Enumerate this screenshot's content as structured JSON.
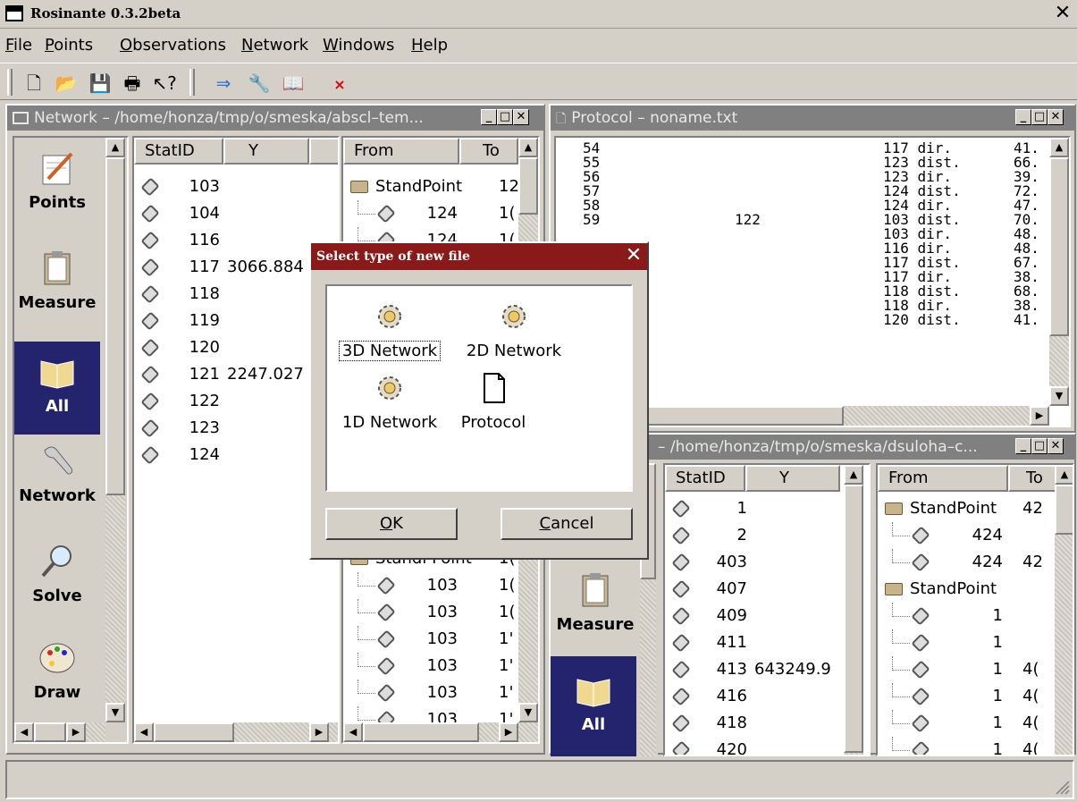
{
  "app": {
    "title": "Rosinante 0.3.2beta"
  },
  "menu": [
    {
      "label": "File",
      "key": "F",
      "rest": "ile"
    },
    {
      "label": "Points",
      "key": "P",
      "rest": "oints"
    },
    {
      "label": "Observations",
      "key": "O",
      "rest": "bservations"
    },
    {
      "label": "Network",
      "key": "N",
      "rest": "etwork"
    },
    {
      "label": "Windows",
      "key": "W",
      "rest": "indows"
    },
    {
      "label": "Help",
      "key": "H",
      "rest": "elp"
    }
  ],
  "toolbar": {
    "icons": [
      "new-file-icon",
      "open-folder-icon",
      "save-disk-icon",
      "print-icon",
      "whats-this-icon",
      "arrow-right-icon",
      "wrench-icon",
      "open-book-icon",
      "close-x-icon"
    ]
  },
  "network_window": {
    "title": "Network – /home/honza/tmp/o/smeska/abscl–tem...",
    "sidebar": [
      "Points",
      "Measure",
      "All",
      "Network",
      "Solve",
      "Draw"
    ],
    "selected_sidebar": "All",
    "points_header": [
      "StatID",
      "Y"
    ],
    "points": [
      {
        "id": "103",
        "y": ""
      },
      {
        "id": "104",
        "y": ""
      },
      {
        "id": "116",
        "y": ""
      },
      {
        "id": "117",
        "y": "3066.884"
      },
      {
        "id": "118",
        "y": ""
      },
      {
        "id": "119",
        "y": ""
      },
      {
        "id": "120",
        "y": ""
      },
      {
        "id": "121",
        "y": "2247.027"
      },
      {
        "id": "122",
        "y": ""
      },
      {
        "id": "123",
        "y": ""
      },
      {
        "id": "124",
        "y": ""
      }
    ],
    "obs_header": [
      "From",
      "To"
    ],
    "obs_top": [
      {
        "kind": "standpoint",
        "label": "StandPoint",
        "to": "12"
      },
      {
        "kind": "point",
        "label": "124",
        "to": "1("
      },
      {
        "kind": "point",
        "label": "124",
        "to": "1("
      }
    ],
    "obs_bottom": [
      {
        "kind": "standpoint",
        "label": "Standi Point",
        "to": "1("
      },
      {
        "kind": "point",
        "label": "103",
        "to": "1("
      },
      {
        "kind": "point",
        "label": "103",
        "to": "1("
      },
      {
        "kind": "point",
        "label": "103",
        "to": "1'"
      },
      {
        "kind": "point",
        "label": "103",
        "to": "1'"
      },
      {
        "kind": "point",
        "label": "103",
        "to": "1'"
      },
      {
        "kind": "point",
        "label": "103",
        "to": "1'"
      }
    ]
  },
  "protocol_window": {
    "title": "Protocol  –  noname.txt",
    "lines": [
      {
        "n": "54",
        "mid": "",
        "obs": "117 dir.",
        "val": "41."
      },
      {
        "n": "55",
        "mid": "",
        "obs": "123 dist.",
        "val": "66."
      },
      {
        "n": "56",
        "mid": "",
        "obs": "123 dir.",
        "val": "39."
      },
      {
        "n": "57",
        "mid": "",
        "obs": "124 dist.",
        "val": "72."
      },
      {
        "n": "58",
        "mid": "",
        "obs": "124 dir.",
        "val": "47."
      },
      {
        "n": "59",
        "mid": "122",
        "obs": "103 dist.",
        "val": "70."
      },
      {
        "n": "",
        "mid": "",
        "obs": "103 dir.",
        "val": "48."
      },
      {
        "n": "",
        "mid": "",
        "obs": "116 dir.",
        "val": "48."
      },
      {
        "n": "",
        "mid": "",
        "obs": "117 dist.",
        "val": "67."
      },
      {
        "n": "",
        "mid": "",
        "obs": "117 dir.",
        "val": "38."
      },
      {
        "n": "",
        "mid": "",
        "obs": "118 dist.",
        "val": "68."
      },
      {
        "n": "",
        "mid": "",
        "obs": "118 dir.",
        "val": "38."
      },
      {
        "n": "",
        "mid": "",
        "obs": "120 dist.",
        "val": "41."
      }
    ]
  },
  "network_window_2": {
    "title": "– /home/honza/tmp/o/smeska/dsuloha–c...",
    "sidebar": [
      "Measure",
      "All"
    ],
    "points_header": [
      "StatID",
      "Y"
    ],
    "points": [
      {
        "id": "1",
        "y": ""
      },
      {
        "id": "2",
        "y": ""
      },
      {
        "id": "403",
        "y": ""
      },
      {
        "id": "407",
        "y": ""
      },
      {
        "id": "409",
        "y": ""
      },
      {
        "id": "411",
        "y": ""
      },
      {
        "id": "413",
        "y": "643249.9"
      },
      {
        "id": "416",
        "y": ""
      },
      {
        "id": "418",
        "y": ""
      },
      {
        "id": "420",
        "y": ""
      }
    ],
    "obs_header": [
      "From",
      "To"
    ],
    "obs": [
      {
        "kind": "standpoint",
        "label": "StandPoint",
        "to": "42"
      },
      {
        "kind": "point",
        "label": "424",
        "to": ""
      },
      {
        "kind": "point",
        "label": "424",
        "to": "42"
      },
      {
        "kind": "standpoint",
        "label": "StandPoint",
        "to": ""
      },
      {
        "kind": "point",
        "label": "1",
        "to": ""
      },
      {
        "kind": "point",
        "label": "1",
        "to": ""
      },
      {
        "kind": "point",
        "label": "1",
        "to": "4("
      },
      {
        "kind": "point",
        "label": "1",
        "to": "4("
      },
      {
        "kind": "point",
        "label": "1",
        "to": "4("
      },
      {
        "kind": "point",
        "label": "1",
        "to": "4("
      }
    ]
  },
  "dialog": {
    "title": "Select type of new file",
    "items": [
      "3D Network",
      "2D Network",
      "1D Network",
      "Protocol"
    ],
    "selected": "3D Network",
    "ok_label": "OK",
    "ok_key": "O",
    "ok_rest": "K",
    "cancel_label": "Cancel",
    "cancel_key": "C",
    "cancel_rest": "ancel"
  },
  "colors": {
    "dialog_title_bg": "#8a1a1a",
    "selected_sidebar_bg": "#24246e",
    "inactive_title_bg": "#808080"
  }
}
